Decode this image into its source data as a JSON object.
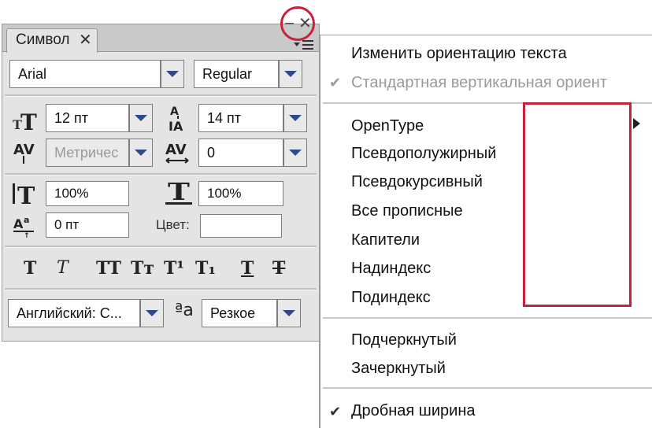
{
  "panel": {
    "tab_label": "Символ",
    "tab_close": "✕",
    "minimize": "–",
    "close": "✕",
    "font_family": "Arial",
    "font_style": "Regular",
    "font_size": "12 пт",
    "leading": "14 пт",
    "kerning": "Метричес",
    "tracking": "0",
    "vertical_scale": "100%",
    "horizontal_scale": "100%",
    "baseline_shift": "0 пт",
    "color_label": "Цвет:",
    "color_value": "",
    "format_buttons": [
      "T",
      "T",
      "TT",
      "Tт",
      "T¹",
      "T₁",
      "T",
      "T"
    ],
    "language": "Английский: С...",
    "antialias_icon_label": "ªa",
    "antialias": "Резкое"
  },
  "menu": {
    "items": [
      {
        "label": "Изменить ориентацию текста",
        "checked": false,
        "disabled": false
      },
      {
        "label": "Стандартная вертикальная ориент",
        "checked": true,
        "disabled": true
      },
      {
        "label": "OpenType",
        "checked": false,
        "disabled": false,
        "submenu": true
      },
      {
        "label": "Псевдополужирный",
        "checked": false,
        "disabled": false
      },
      {
        "label": "Псевдокурсивный",
        "checked": false,
        "disabled": false
      },
      {
        "label": "Все прописные",
        "checked": false,
        "disabled": false
      },
      {
        "label": "Капители",
        "checked": false,
        "disabled": false
      },
      {
        "label": "Надиндекс",
        "checked": false,
        "disabled": false
      },
      {
        "label": "Подиндекс",
        "checked": false,
        "disabled": false
      },
      {
        "label": "Подчеркнутый",
        "checked": false,
        "disabled": false
      },
      {
        "label": "Зачеркнутый",
        "checked": false,
        "disabled": false
      },
      {
        "label": "Дробная ширина",
        "checked": true,
        "disabled": false
      }
    ],
    "check_glyph": "✔"
  },
  "colors": {
    "highlight_red": "#c8213e",
    "dropdown_arrow": "#2d4a8a",
    "panel_bg": "#e4e4e4"
  },
  "icons": [
    "font-size-icon",
    "leading-icon",
    "kerning-icon",
    "tracking-icon",
    "vertical-scale-icon",
    "horizontal-scale-icon",
    "baseline-shift-icon",
    "antialias-icon",
    "panel-menu-icon",
    "submenu-arrow-icon",
    "check-icon"
  ]
}
